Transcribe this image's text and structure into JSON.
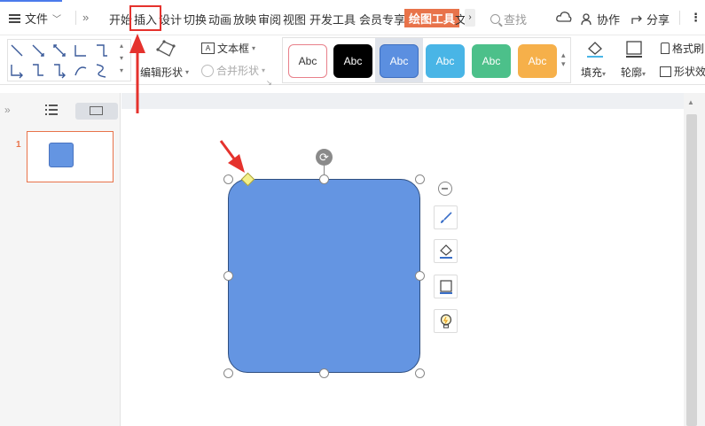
{
  "menubar": {
    "file_label": "文件",
    "tabs": [
      "开始",
      "插入",
      "设计",
      "切换",
      "动画",
      "放映",
      "审阅",
      "视图",
      "开发工具",
      "会员专享",
      "绘图工具",
      "文"
    ],
    "active_tab": "绘图工具",
    "search_label": "查找",
    "collab_label": "协作",
    "share_label": "分享"
  },
  "ribbon": {
    "edit_shape_label": "编辑形状",
    "textbox_label": "文本框",
    "merge_shape_label": "合并形状",
    "style_preset_text": "Abc",
    "style_presets": [
      {
        "bg": "#ffffff",
        "fg": "#333333",
        "border": "#e8808a"
      },
      {
        "bg": "#000000",
        "fg": "#ffffff",
        "border": "#000000"
      },
      {
        "bg": "#5b8fe0",
        "fg": "#ffffff",
        "border": "#3e6fc0"
      },
      {
        "bg": "#49b5e6",
        "fg": "#ffffff",
        "border": "#49b5e6"
      },
      {
        "bg": "#4cc08a",
        "fg": "#ffffff",
        "border": "#4cc08a"
      },
      {
        "bg": "#f6b04a",
        "fg": "#ffffff",
        "border": "#f6b04a"
      }
    ],
    "fill_label": "填充",
    "outline_label": "轮廓",
    "format_painter_label": "格式刷",
    "shape_effect_label": "形状效"
  },
  "slides_panel": {
    "slide_number": "1"
  },
  "colors": {
    "accent": "#e8734a",
    "shape_fill": "#6495e2",
    "annotation_red": "#e5322d"
  }
}
